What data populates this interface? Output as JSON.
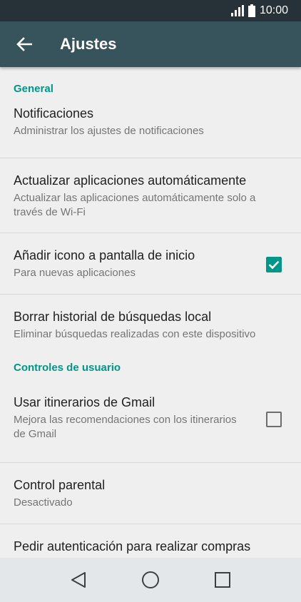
{
  "status_bar": {
    "time": "10:00"
  },
  "app_bar": {
    "title": "Ajustes"
  },
  "sections": {
    "general": "General",
    "user_controls": "Controles de usuario"
  },
  "items": {
    "notifications": {
      "title": "Notificaciones",
      "subtitle": "Administrar los ajustes de notificaciones"
    },
    "auto_update": {
      "title": "Actualizar aplicaciones automáticamente",
      "subtitle": "Actualizar las aplicaciones automáticamente solo a través de Wi-Fi"
    },
    "add_icon": {
      "title": "Añadir icono a pantalla de inicio",
      "subtitle": "Para nuevas aplicaciones",
      "checked": true
    },
    "clear_history": {
      "title": "Borrar historial de búsquedas  local",
      "subtitle": "Eliminar búsquedas realizadas con este dispositivo"
    },
    "gmail_itineraries": {
      "title": "Usar itinerarios de Gmail",
      "subtitle": "Mejora las recomendaciones con los itinerarios de Gmail",
      "checked": false
    },
    "parental_control": {
      "title": "Control parental",
      "subtitle": "Desactivado"
    },
    "purchase_auth": {
      "title": "Pedir autenticación para realizar compras"
    }
  },
  "colors": {
    "status_bar": "#263238",
    "app_bar": "#37535b",
    "accent": "#009688",
    "background": "#efefef",
    "nav_bar": "#e4e7ea"
  },
  "icons": {
    "back": "arrow-left-icon",
    "signal": "signal-icon",
    "battery": "battery-icon",
    "nav_back": "triangle-back-icon",
    "nav_home": "circle-home-icon",
    "nav_recents": "square-recents-icon"
  }
}
